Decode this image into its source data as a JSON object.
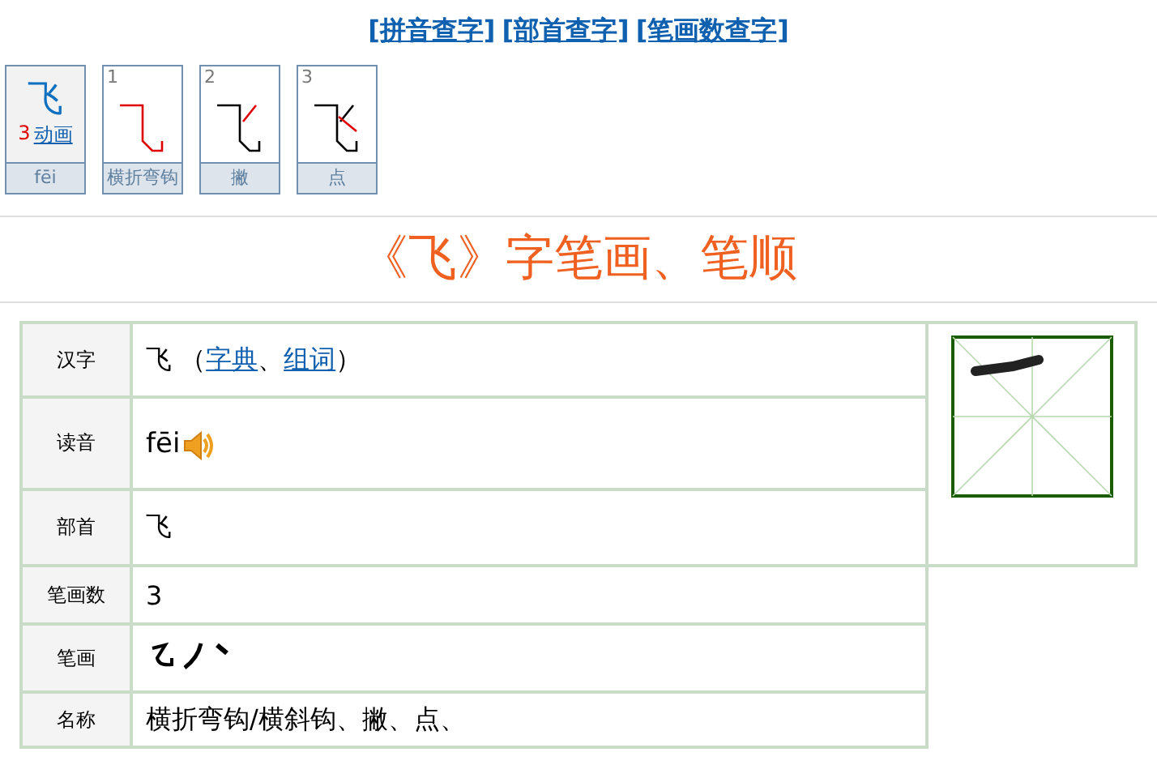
{
  "nav_links": [
    "[拼音查字]",
    "[部首查字]",
    "[笔画数查字]"
  ],
  "summary_card": {
    "character": "飞",
    "stroke_count": "3",
    "animation_link": "动画",
    "pinyin": "fēi"
  },
  "stroke_steps": [
    {
      "number": "1",
      "name": "横折弯钩"
    },
    {
      "number": "2",
      "name": "撇"
    },
    {
      "number": "3",
      "name": "点"
    }
  ],
  "title": "《飞》字笔画、笔顺",
  "table": {
    "rows": [
      {
        "label": "汉字",
        "kind": "parts",
        "parts": [
          {
            "kind": "text",
            "text": "飞 （"
          },
          {
            "kind": "link",
            "text": "字典"
          },
          {
            "kind": "text",
            "text": "、"
          },
          {
            "kind": "link",
            "text": "组词"
          },
          {
            "kind": "text",
            "text": "）"
          }
        ]
      },
      {
        "label": "读音",
        "kind": "audio",
        "value": "fēi"
      },
      {
        "label": "部首",
        "kind": "plain",
        "value": "飞"
      },
      {
        "label": "笔画数",
        "kind": "plain",
        "value": "3"
      },
      {
        "label": "笔画",
        "kind": "strokes"
      },
      {
        "label": "名称",
        "kind": "plain",
        "value": "横折弯钩/横斜钩、撇、点、"
      }
    ]
  }
}
